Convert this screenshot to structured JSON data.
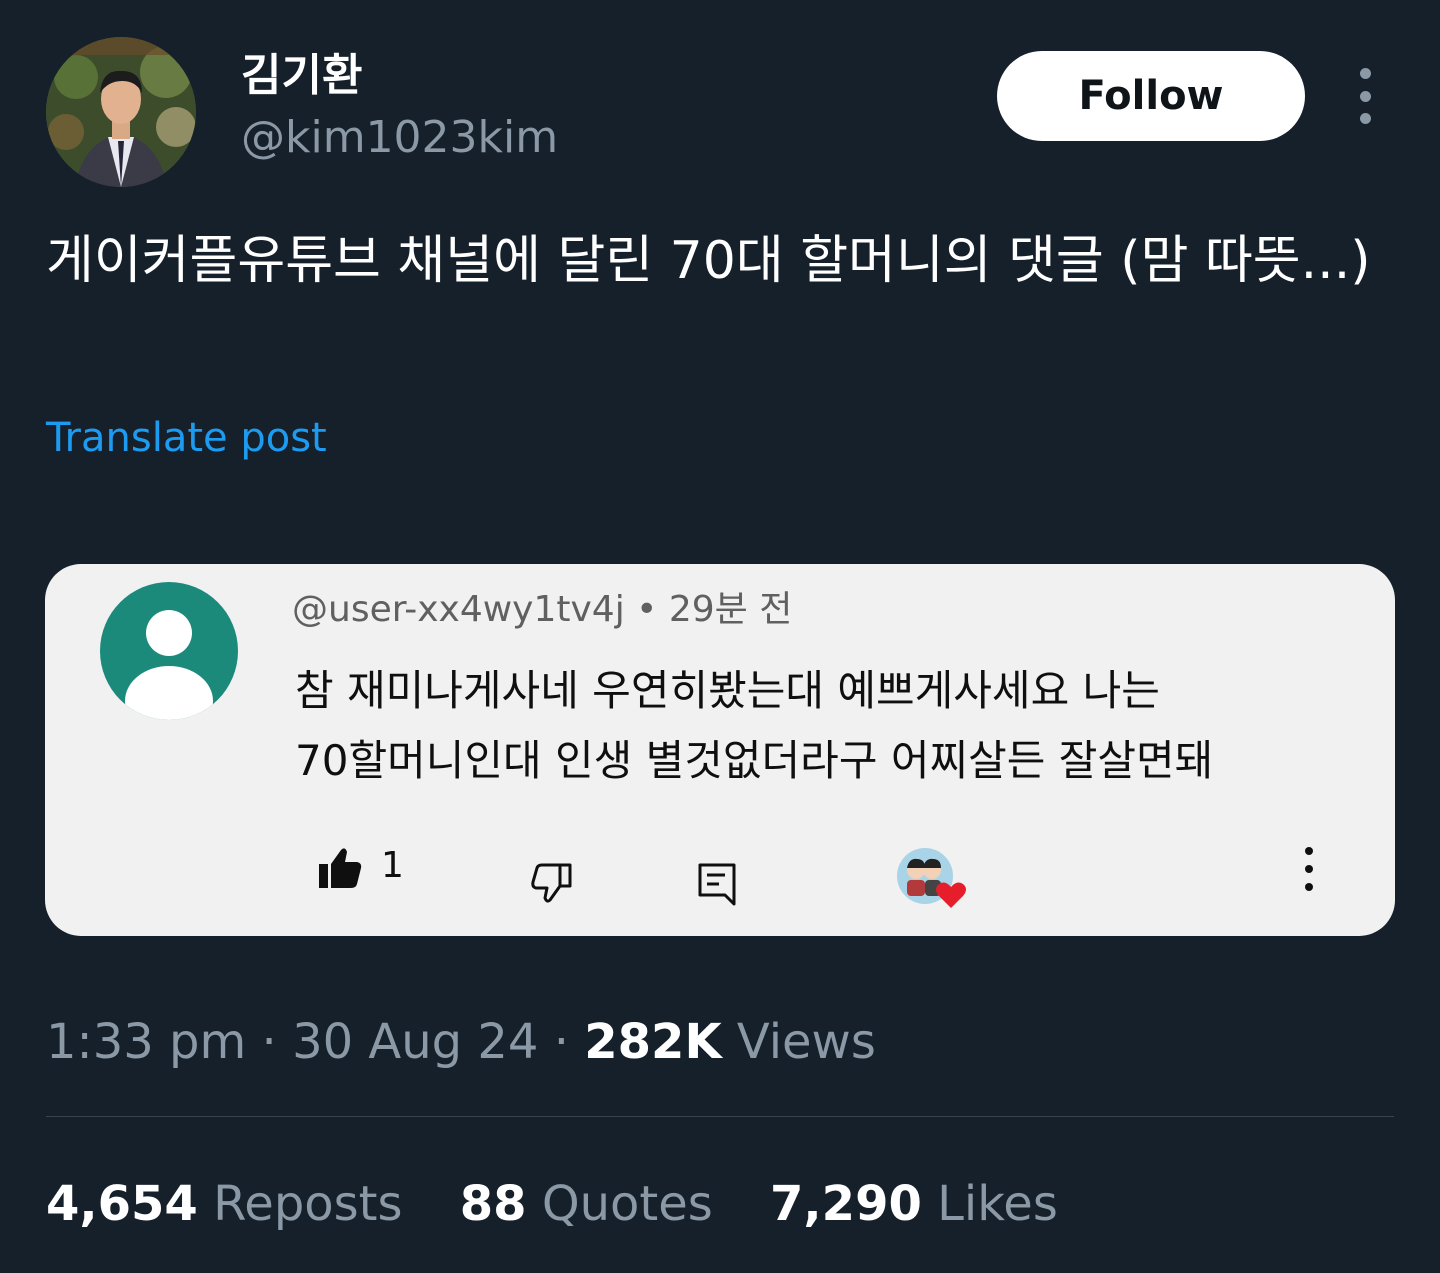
{
  "author": {
    "display_name": "김기환",
    "handle": "@kim1023kim"
  },
  "header": {
    "follow_label": "Follow",
    "more_icon": "more-vertical-icon"
  },
  "post": {
    "text": "게이커플유튜브 채널에 달린 70대 할머니의 댓글 (맘 따뜻...)",
    "translate_label": "Translate post"
  },
  "embedded_comment": {
    "username": "@user-xx4wy1tv4j",
    "time_ago": "29분 전",
    "text": "참  재미나게사네  우연히봤는대  예쁘게사세요 나는\n70할머니인대  인생 별것없더라구  어찌살든  잘살면돼",
    "like_count": "1",
    "avatar_color": "#1b8a7b"
  },
  "meta": {
    "time": "1:33 pm",
    "date": "30 Aug 24",
    "views_count": "282K",
    "views_label": "Views"
  },
  "stats": {
    "reposts_count": "4,654",
    "reposts_label": "Reposts",
    "quotes_count": "88",
    "quotes_label": "Quotes",
    "likes_count": "7,290",
    "likes_label": "Likes"
  },
  "colors": {
    "background": "#15202b",
    "accent": "#1d9bf0",
    "secondary_text": "#8b98a5"
  }
}
